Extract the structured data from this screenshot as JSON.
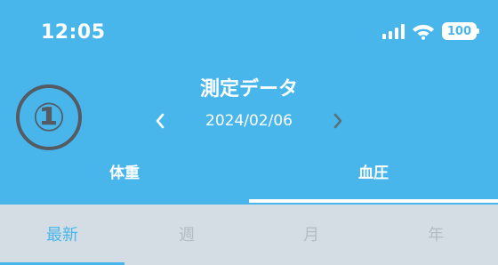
{
  "status_bar": {
    "time": "12:05",
    "battery": "100"
  },
  "annotation": "①",
  "header": {
    "title": "測定データ",
    "date": "2024/02/06"
  },
  "main_tabs": [
    {
      "label": "体重",
      "active": false
    },
    {
      "label": "血圧",
      "active": true
    }
  ],
  "sub_tabs": [
    {
      "label": "最新",
      "active": true
    },
    {
      "label": "週",
      "active": false
    },
    {
      "label": "月",
      "active": false
    },
    {
      "label": "年",
      "active": false
    }
  ],
  "colors": {
    "accent": "#48b6ea",
    "sub_tab_bg": "#d4dde3",
    "inactive_text": "#b1bcc4",
    "annotation": "#555b63"
  },
  "icons": {
    "signal": "signal-bars-icon",
    "wifi": "wifi-icon",
    "battery": "battery-icon",
    "prev": "chevron-left-icon",
    "next": "chevron-right-icon"
  }
}
